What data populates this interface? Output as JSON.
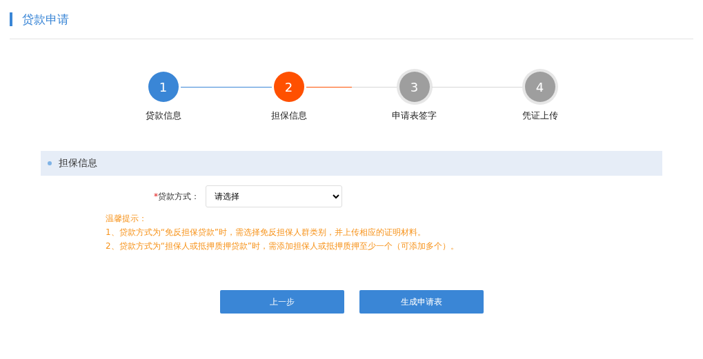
{
  "page_title": "贷款申请",
  "steps": [
    {
      "number": "1",
      "label": "贷款信息",
      "kind": "done"
    },
    {
      "number": "2",
      "label": "担保信息",
      "kind": "current"
    },
    {
      "number": "3",
      "label": "申请表签字",
      "kind": "pending"
    },
    {
      "number": "4",
      "label": "凭证上传",
      "kind": "pending"
    }
  ],
  "section": {
    "title": "担保信息"
  },
  "form": {
    "required_mark": "*",
    "label": "贷款方式：",
    "select_value": "请选择"
  },
  "hints": [
    "温馨提示：",
    "1、贷款方式为“免反担保贷款”时，需选择免反担保人群类别，并上传相应的证明材料。",
    "2、贷款方式为“担保人或抵押质押贷款”时，需添加担保人或抵押质押至少一个（可添加多个）。"
  ],
  "buttons": [
    "上一步",
    "生成申请表"
  ]
}
